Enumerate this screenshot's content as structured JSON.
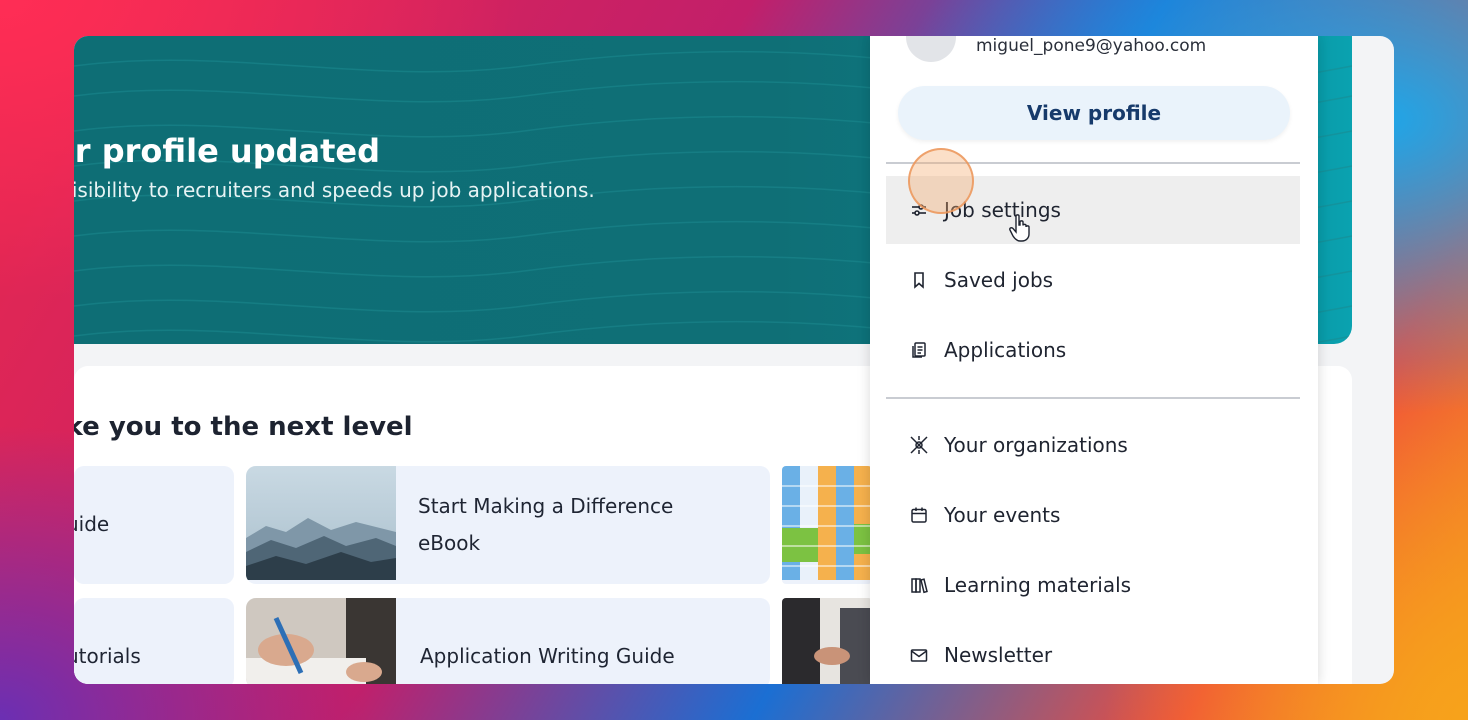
{
  "hero": {
    "title": "ur profile updated",
    "subtitle": "visibility to recruiters and speeds up job applications."
  },
  "section": {
    "title": "ake you to the next level"
  },
  "tiles": [
    {
      "label": "uide"
    },
    {
      "label_line1": "Start Making a Difference",
      "label_line2": "eBook"
    },
    {
      "label": "utorials"
    },
    {
      "label": "Application Writing Guide"
    }
  ],
  "menu": {
    "email": "miguel_pone9@yahoo.com",
    "view_profile": "View profile",
    "items": [
      {
        "label": "Job settings",
        "icon": "sliders-icon"
      },
      {
        "label": "Saved jobs",
        "icon": "bookmark-icon"
      },
      {
        "label": "Applications",
        "icon": "documents-icon"
      },
      {
        "label": "Your organizations",
        "icon": "network-icon"
      },
      {
        "label": "Your events",
        "icon": "calendar-icon"
      },
      {
        "label": "Learning materials",
        "icon": "books-icon"
      },
      {
        "label": "Newsletter",
        "icon": "envelope-icon"
      }
    ]
  },
  "colors": {
    "hero": "#0e6e75",
    "accent_button": "#eaf3fb",
    "tile_bg": "#edf2fb"
  }
}
